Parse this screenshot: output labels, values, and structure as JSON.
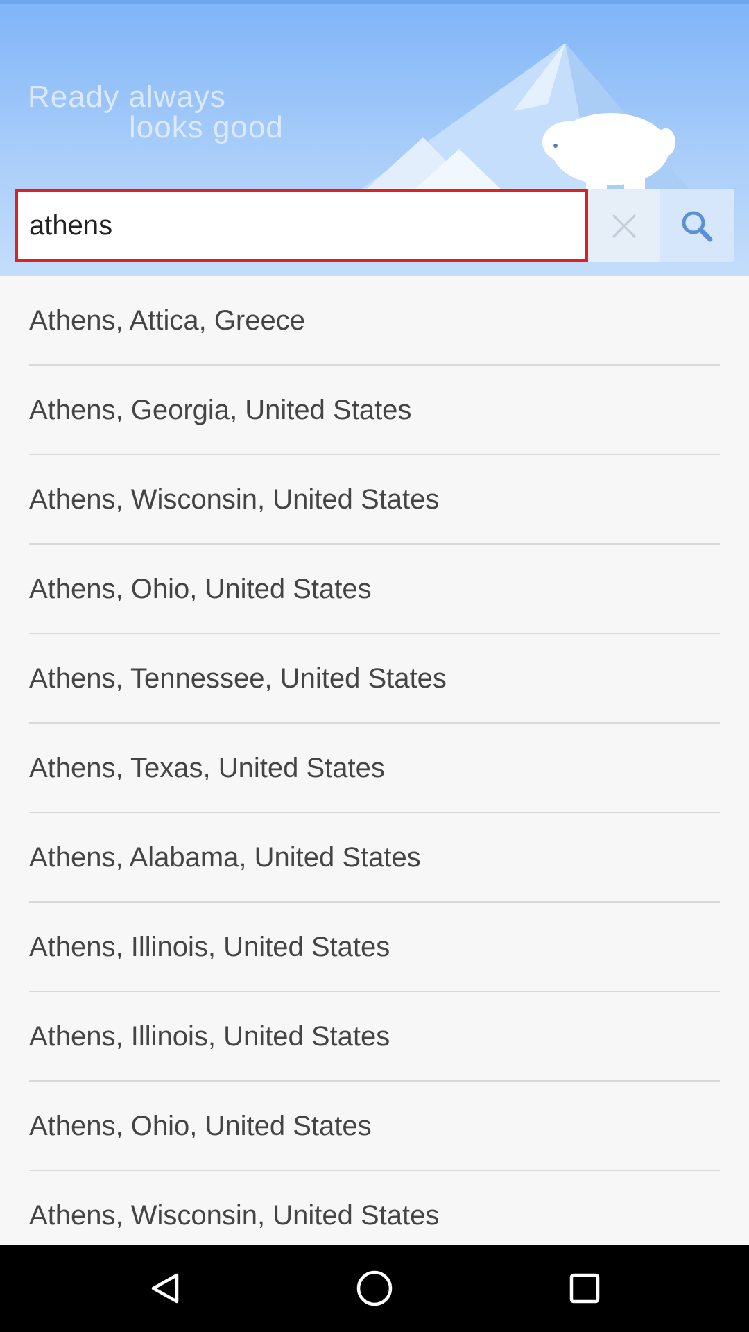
{
  "header": {
    "tagline_line1": "Ready  always",
    "tagline_line2": "looks  good",
    "colors": {
      "sky_top": "#7fb4f8",
      "sky_bottom": "#c4ddfb"
    }
  },
  "search": {
    "value": "athens",
    "clear_icon": "close-icon",
    "search_icon": "search-icon",
    "highlight_color": "#e01f1f"
  },
  "results": [
    {
      "label": "Athens, Attica, Greece"
    },
    {
      "label": "Athens, Georgia, United States"
    },
    {
      "label": "Athens, Wisconsin, United States"
    },
    {
      "label": "Athens, Ohio, United States"
    },
    {
      "label": "Athens, Tennessee, United States"
    },
    {
      "label": "Athens, Texas, United States"
    },
    {
      "label": "Athens, Alabama, United States"
    },
    {
      "label": "Athens, Illinois, United States"
    },
    {
      "label": "Athens, Illinois, United States"
    },
    {
      "label": "Athens, Ohio, United States"
    },
    {
      "label": "Athens, Wisconsin, United States"
    }
  ],
  "nav": {
    "back_icon": "back-triangle-icon",
    "home_icon": "home-circle-icon",
    "recents_icon": "recents-square-icon"
  }
}
